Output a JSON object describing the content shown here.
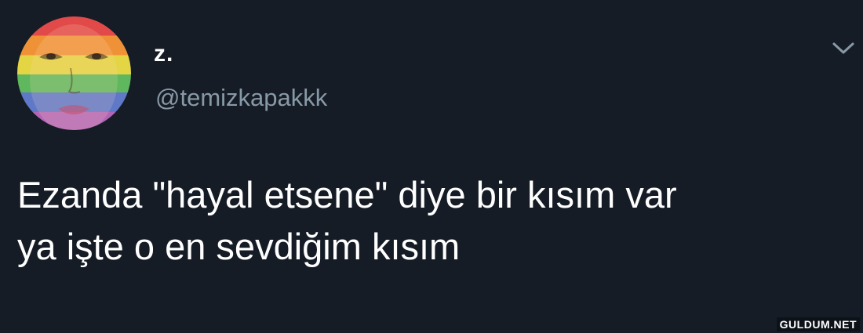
{
  "tweet": {
    "display_name": "z.",
    "handle": "@temizkapakkk",
    "text_line1": "Ezanda \"hayal etsene\" diye bir kısım var",
    "text_line2": "ya işte o en sevdiğim kısım",
    "avatar_icon": "rainbow-flag-face-avatar",
    "menu_icon": "chevron-down-icon"
  },
  "watermark": {
    "text": "GULDUM.NET"
  },
  "colors": {
    "background": "#151c26",
    "text_primary": "#ffffff",
    "text_secondary": "#8899a6"
  }
}
